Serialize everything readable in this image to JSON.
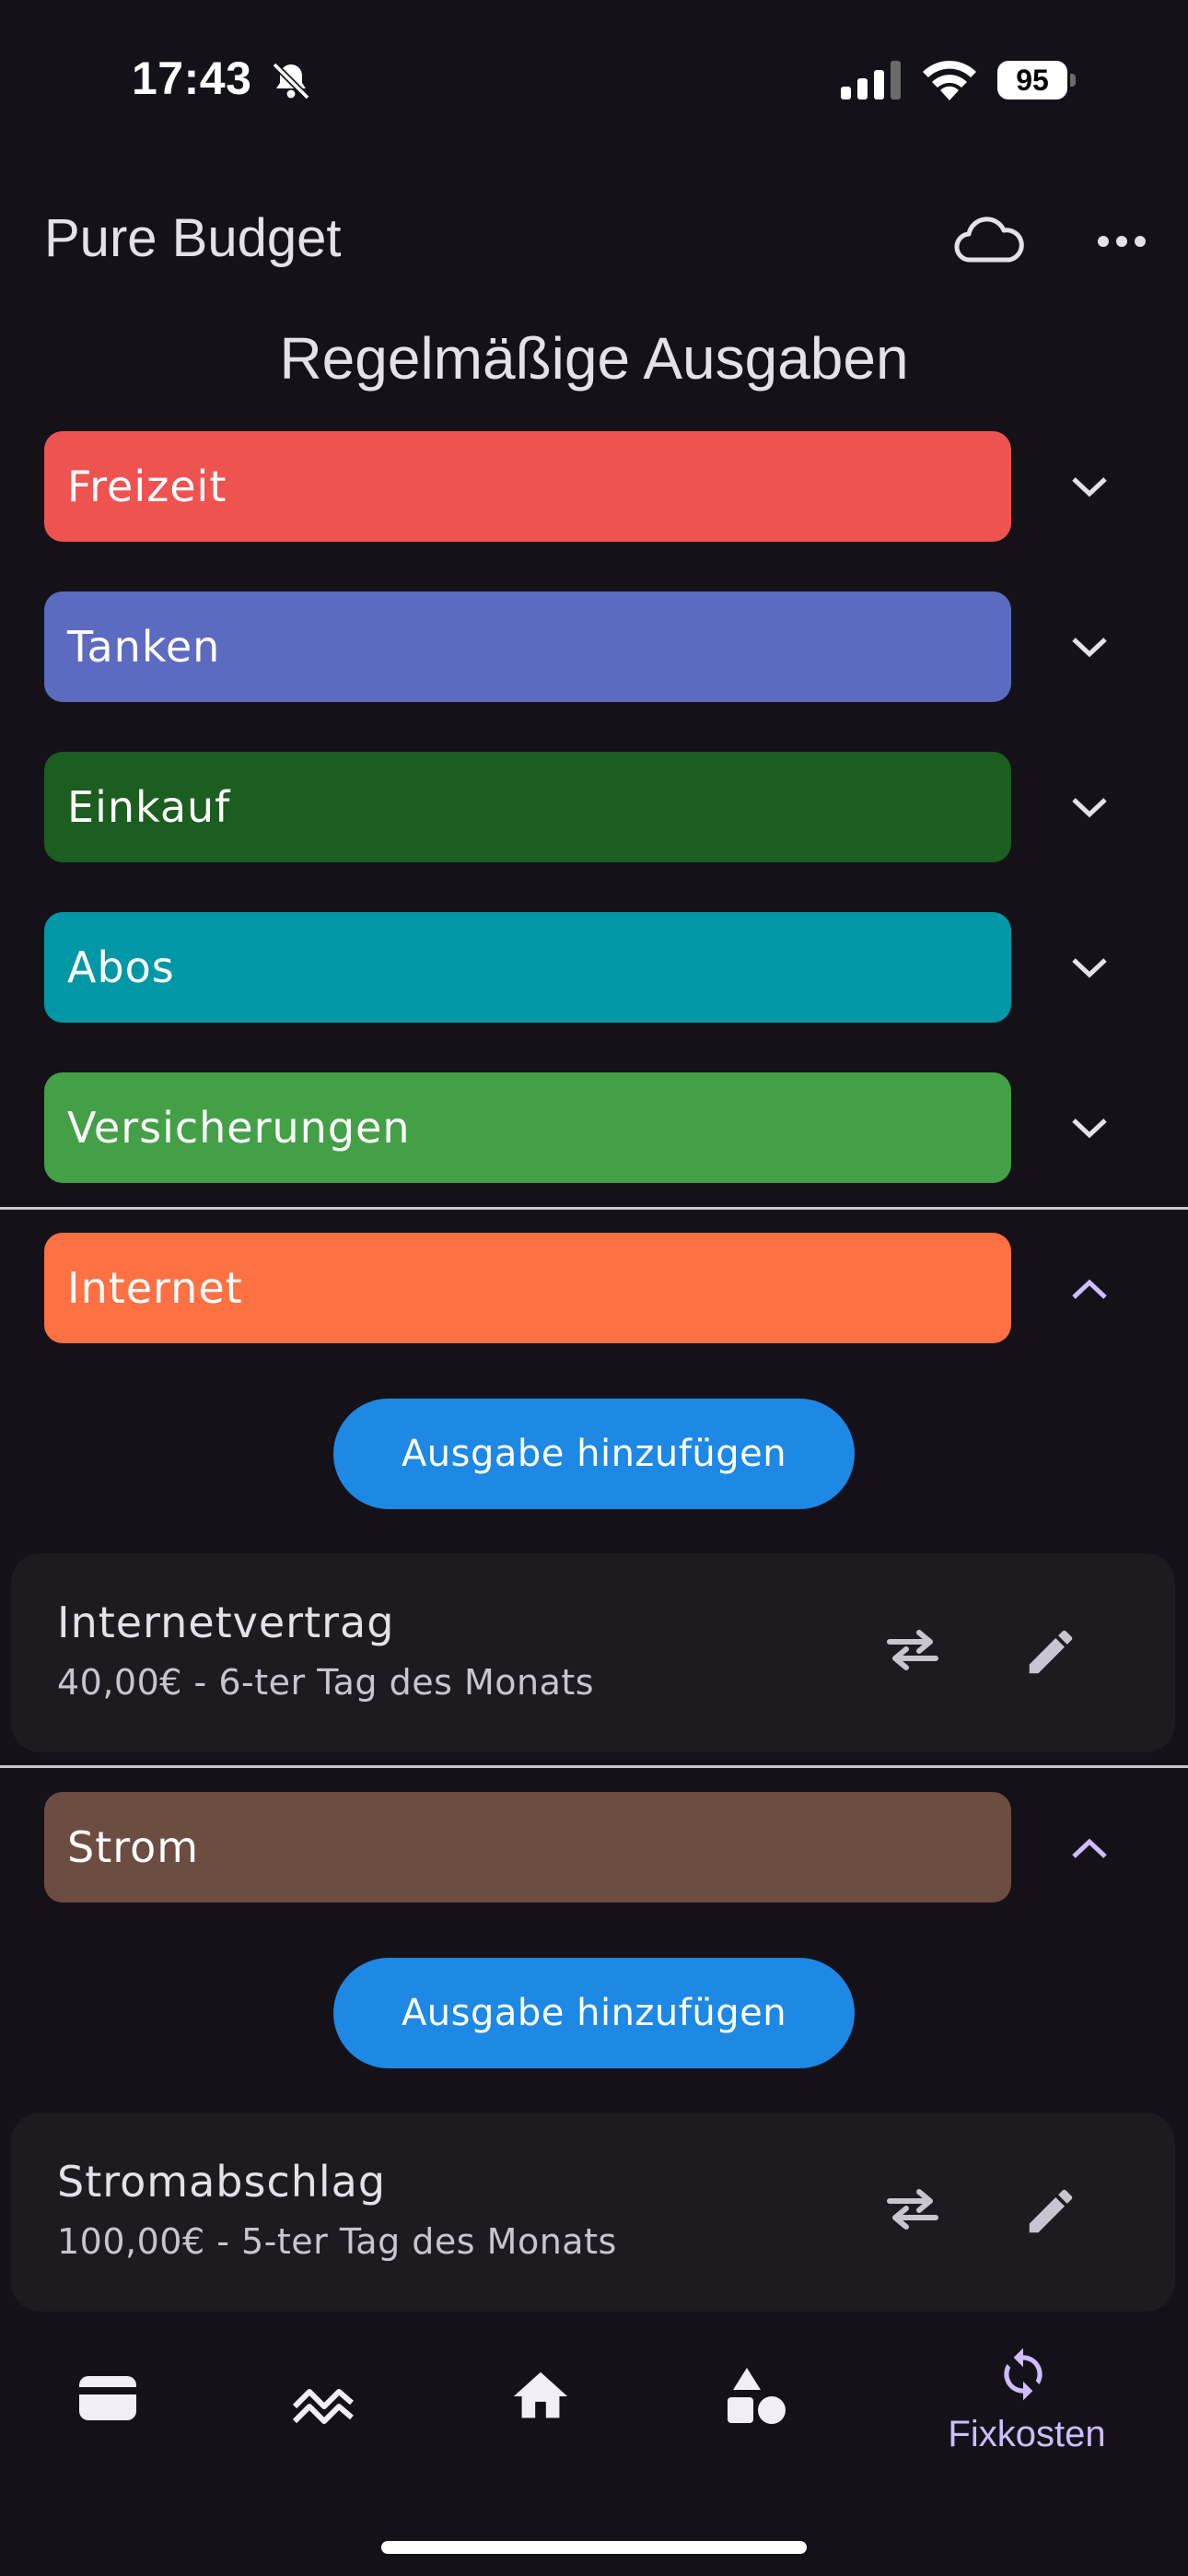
{
  "status_bar": {
    "time": "17:43",
    "battery": "95"
  },
  "app_bar": {
    "title": "Pure Budget"
  },
  "section_title": "Regelmäßige Ausgaben",
  "categories": [
    {
      "label": "Freizeit",
      "color": "#ef5350",
      "expanded": false
    },
    {
      "label": "Tanken",
      "color": "#5c6bc0",
      "expanded": false
    },
    {
      "label": "Einkauf",
      "color": "#1b5e20",
      "expanded": false
    },
    {
      "label": "Abos",
      "color": "#0097a7",
      "expanded": false
    },
    {
      "label": "Versicherungen",
      "color": "#43a047",
      "expanded": false
    },
    {
      "label": "Internet",
      "color": "#ff7043",
      "expanded": true
    },
    {
      "label": "Strom",
      "color": "#6d4c41",
      "expanded": true
    }
  ],
  "internet": {
    "add_button": "Ausgabe hinzufügen",
    "expense": {
      "title": "Internetvertrag",
      "subtitle": "40,00€ - 6-ter Tag des Monats"
    }
  },
  "strom": {
    "add_button": "Ausgabe hinzufügen",
    "expense": {
      "title": "Stromabschlag",
      "subtitle": "100,00€ - 5-ter Tag des Monats"
    }
  },
  "bottom_nav": {
    "items": [
      "wallet-icon",
      "chart-icon",
      "home-icon",
      "categories-icon",
      "repeat-icon"
    ],
    "active_label": "Fixkosten"
  },
  "colors": {
    "accent": "#1e88e5",
    "active_nav": "#d0bcff",
    "background": "#141218"
  }
}
